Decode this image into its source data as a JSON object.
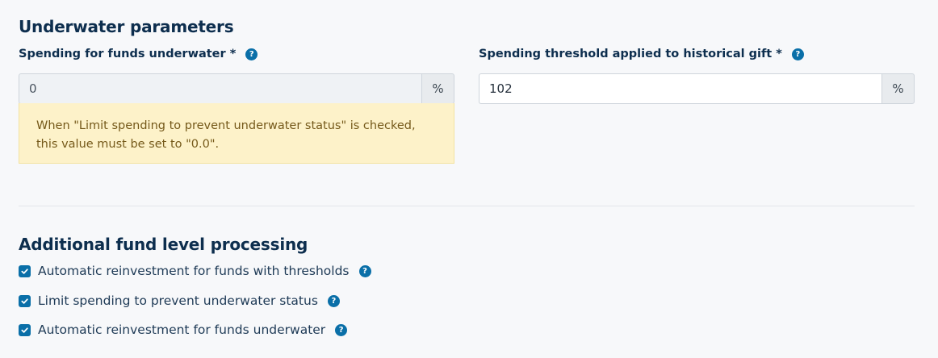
{
  "underwater": {
    "title": "Underwater parameters",
    "spending_field": {
      "label": "Spending for funds underwater *",
      "value": "0",
      "unit": "%"
    },
    "threshold_field": {
      "label": "Spending threshold applied to historical gift *",
      "value": "102",
      "unit": "%"
    },
    "warning": {
      "line1": "When \"Limit spending to prevent underwater status\" is checked,",
      "line2": "this value must be set to \"0.0\"."
    }
  },
  "additional": {
    "title": "Additional fund level processing",
    "options": [
      {
        "label": "Automatic reinvestment for funds with thresholds",
        "checked": true
      },
      {
        "label": "Limit spending to prevent underwater status",
        "checked": true
      },
      {
        "label": "Automatic reinvestment for funds underwater",
        "checked": true
      }
    ]
  },
  "icons": {
    "help": "question-mark-icon",
    "checkbox": "checkmark-icon"
  },
  "colors": {
    "accent": "#0a6fa8",
    "heading": "#0d2e4e",
    "warning_bg": "#fdf2c9",
    "warning_text": "#75591a"
  }
}
